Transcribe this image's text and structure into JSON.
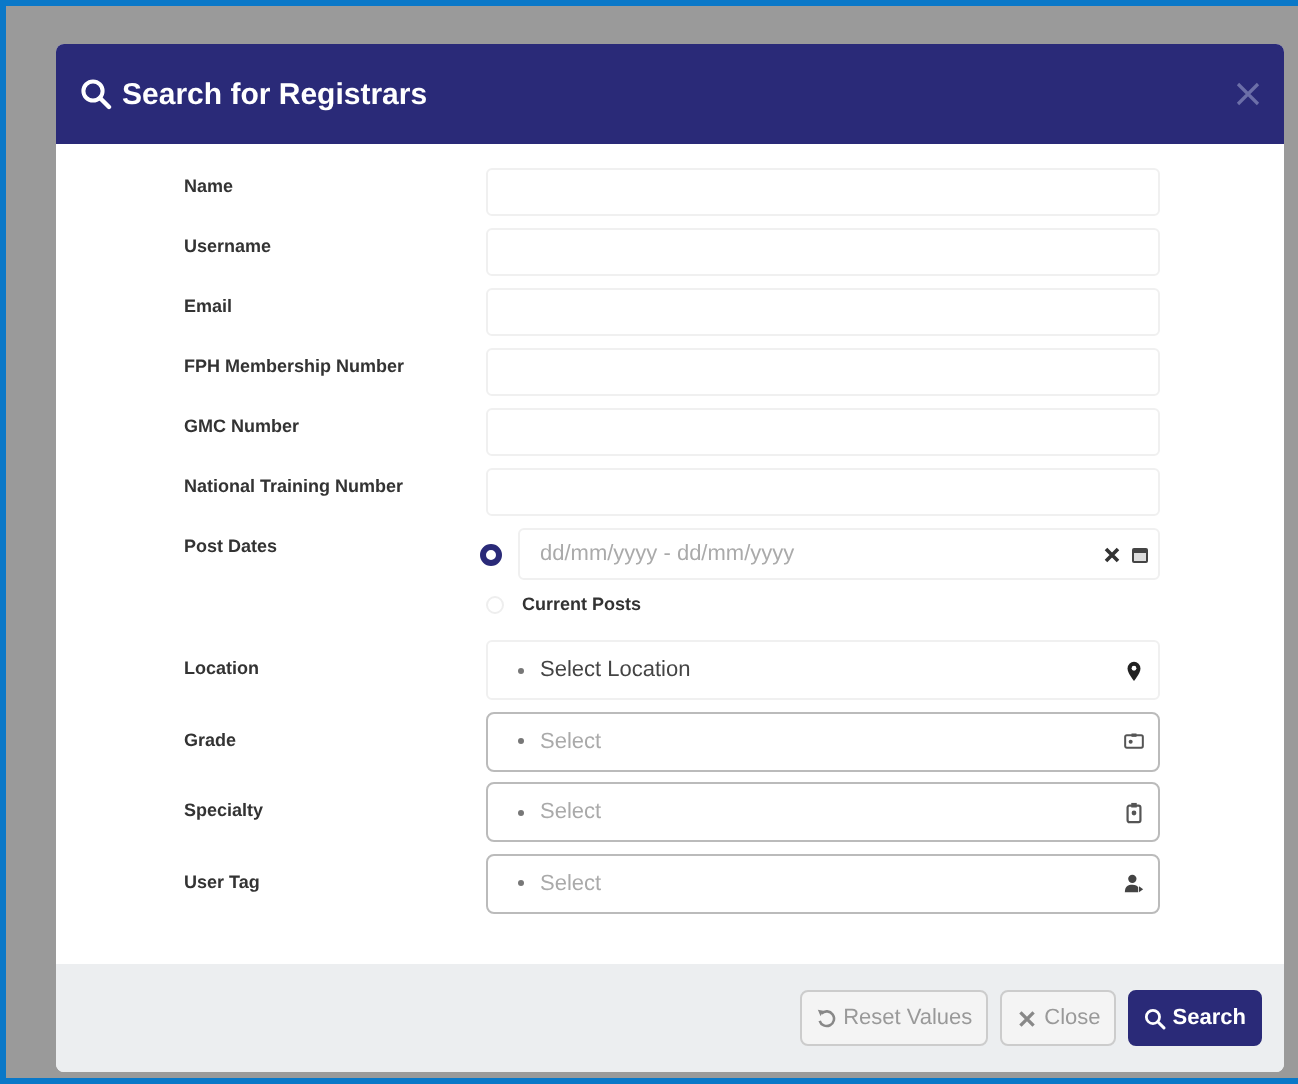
{
  "dialog": {
    "title": "Search for Registrars"
  },
  "fields": [
    {
      "kind": "text",
      "label": "Name"
    },
    {
      "kind": "text",
      "label": "Username"
    },
    {
      "kind": "text",
      "label": "Email"
    },
    {
      "kind": "text",
      "label": "FPH Membership Number"
    },
    {
      "kind": "text",
      "label": "GMC Number"
    },
    {
      "kind": "text",
      "label": "National Training Number"
    },
    {
      "kind": "daterange",
      "label": "Post Dates",
      "placeholder": "dd/mm/yyyy - dd/mm/yyyy",
      "options": [
        {
          "selected": true
        },
        {
          "label": "Current Posts",
          "selected": false
        }
      ]
    },
    {
      "kind": "location",
      "label": "Location",
      "placeholder": "Select Location"
    },
    {
      "kind": "card",
      "label": "Grade",
      "placeholder": "Select"
    },
    {
      "kind": "badge",
      "label": "Specialty",
      "placeholder": "Select"
    },
    {
      "kind": "person",
      "label": "User Tag",
      "placeholder": "Select"
    }
  ],
  "buttons": [
    {
      "kind": "reset",
      "label": "Reset Values"
    },
    {
      "kind": "close",
      "label": "Close"
    },
    {
      "kind": "search",
      "label": "Search"
    }
  ]
}
